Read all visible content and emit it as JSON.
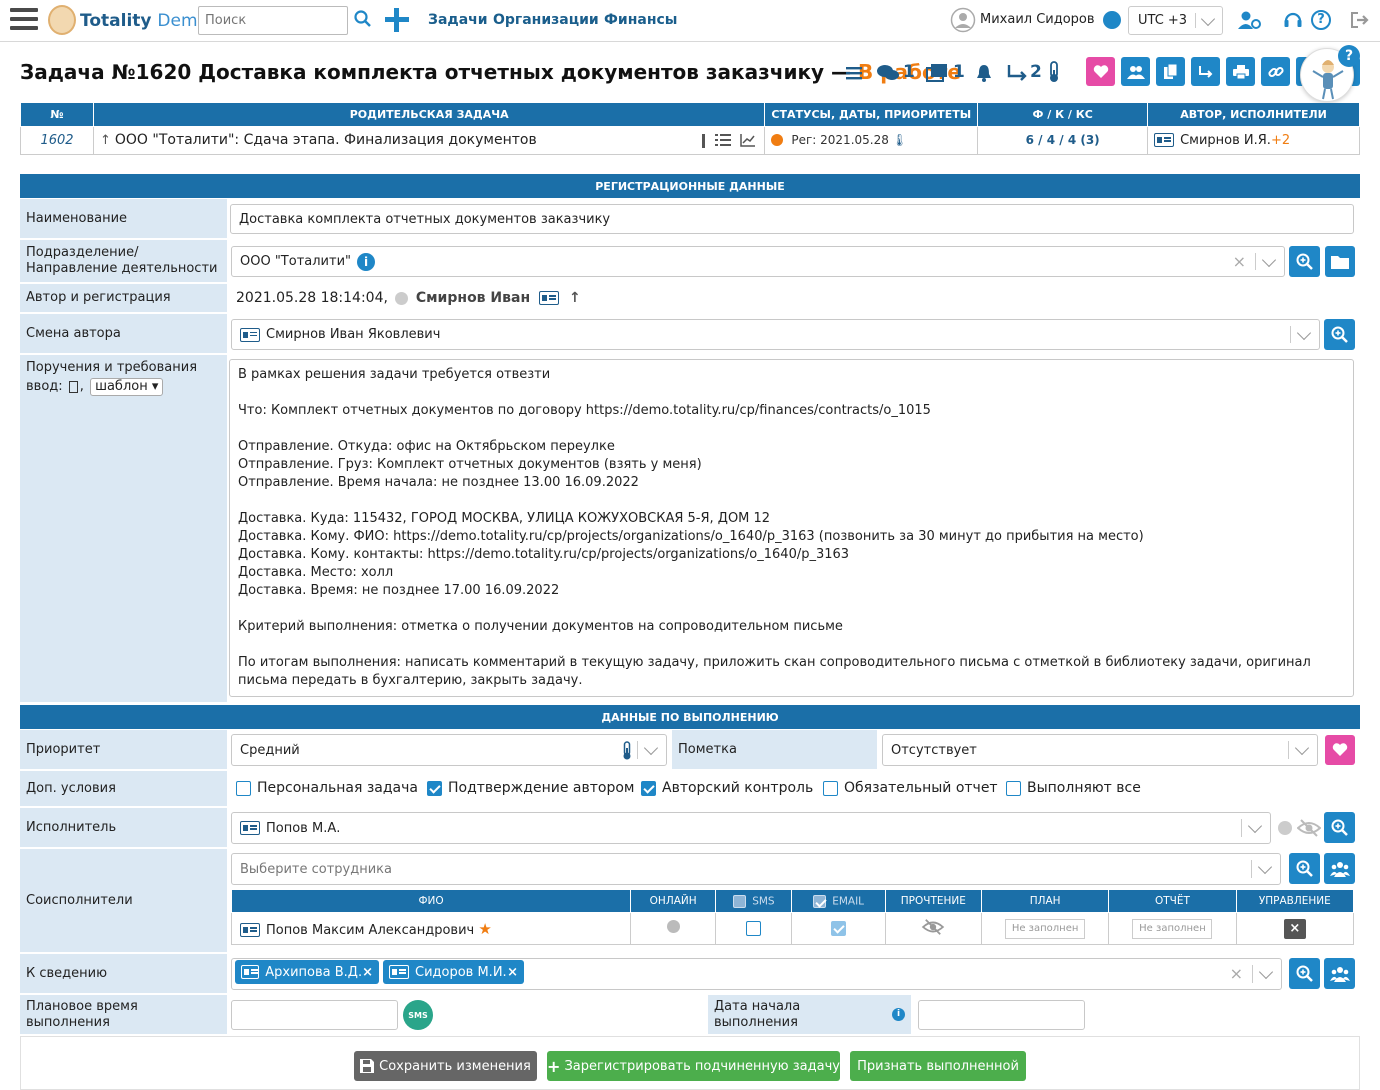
{
  "topbar": {
    "brand": "Totality",
    "brand_demo": "Demo",
    "search_placeholder": "Поиск",
    "nav": [
      "Задачи",
      "Организации",
      "Финансы"
    ],
    "user_name": "Михаил Сидоров",
    "timezone": "UTC +3"
  },
  "task": {
    "title": "Задача №1620 Доставка комплекта отчетных документов заказчику —",
    "status": "В работе",
    "comments_count": "1",
    "subtasks_count": "1",
    "moves_count": "2",
    "status_color": "#f07d12"
  },
  "summary": {
    "headers": [
      "№",
      "Родительская задача",
      "Статусы, даты, приоритеты",
      "Ф / К / КС",
      "Автор, исполнители"
    ],
    "parent_number": "1602",
    "parent_name": "ООО \"Тоталити\": Сдача этапа. Финализация документов",
    "reg_date": "Рег: 2021.05.28",
    "fkks": "6 / 4 / 4 (3)",
    "author": "Смирнов И.Я.",
    "author_extra": "+2"
  },
  "registration": {
    "header": "Регистрационные данные",
    "name_label": "Наименование",
    "name_value": "Доставка комплекта отчетных документов заказчику",
    "division_label": "Подразделение/ Направление деятельности",
    "division_value": "ООО \"Тоталити\"",
    "author_label": "Автор и регистрация",
    "author_value": "2021.05.28 18:14:04,",
    "author_name": "Смирнов Иван",
    "change_author_label": "Смена автора",
    "change_author_value": "Смирнов Иван Яковлевич",
    "instructions_label": "Поручения и требования",
    "input_label": "ввод:",
    "template_label": "шаблон",
    "instructions_text": "В рамках решения задачи требуется отвезти\n\nЧто: Комплект отчетных документов по договору https://demo.totality.ru/cp/finances/contracts/o_1015\n\nОтправление. Откуда: офис на Октябрьском переулке\nОтправление. Груз: Комплект отчетных документов (взять у меня)\nОтправление. Время начала: не позднее 13.00 16.09.2022\n\nДоставка. Куда: 115432, ГОРОД МОСКВА, УЛИЦА КОЖУХОВСКАЯ 5-Я, ДОМ 12\nДоставка. Кому. ФИО: https://demo.totality.ru/cp/projects/organizations/o_1640/p_3163 (позвонить за 30 минут до прибытия на место)\nДоставка. Кому. контакты: https://demo.totality.ru/cp/projects/organizations/o_1640/p_3163\nДоставка. Место: холл\nДоставка. Время: не позднее 17.00 16.09.2022\n\nКритерий выполнения: отметка о получении документов на сопроводительном письме\n\nПо итогам выполнения: написать комментарий в текущую задачу, приложить скан сопроводительного письма с отметкой в библиотеку задачи, оригинал письма передать в бухгалтерию, закрыть задачу."
  },
  "execution": {
    "header": "Данные по выполнению",
    "priority_label": "Приоритет",
    "priority_value": "Средний",
    "mark_label": "Пометка",
    "mark_value": "Отсутствует",
    "conditions_label": "Доп. условия",
    "conditions": [
      {
        "label": "Персональная задача",
        "checked": false
      },
      {
        "label": "Подтверждение автором",
        "checked": true
      },
      {
        "label": "Авторский контроль",
        "checked": true
      },
      {
        "label": "Обязательный отчет",
        "checked": false
      },
      {
        "label": "Выполняют все",
        "checked": false
      }
    ],
    "executor_label": "Исполнитель",
    "executor_value": "Попов М.А.",
    "coexec_label": "Соисполнители",
    "coexec_placeholder": "Выберите сотрудника",
    "coexec_headers": [
      "ФИО",
      "Онлайн",
      "SMS",
      "Email",
      "Прочтение",
      "План",
      "Отчёт",
      "Управление"
    ],
    "coexec_row_name": "Попов Максим Александрович",
    "plan_placeholder": "Не заполнен",
    "report_placeholder": "Не заполнен",
    "info_label": "К сведению",
    "info_tags": [
      "Архипова В.Д.",
      "Сидоров М.И."
    ],
    "plan_time_label": "Плановое время выполнения",
    "start_date_label": "Дата начала выполнения",
    "sms_label": "SMS"
  },
  "buttons": {
    "save": "Сохранить изменения",
    "register_sub": "Зарегистрировать подчиненную задачу",
    "complete": "Признать выполненной"
  },
  "colors": {
    "header_blue": "#1b6fa8",
    "accent_blue": "#1f87c7",
    "pink": "#e64ba6",
    "green": "#4cae4c",
    "gray_button": "#666666"
  }
}
